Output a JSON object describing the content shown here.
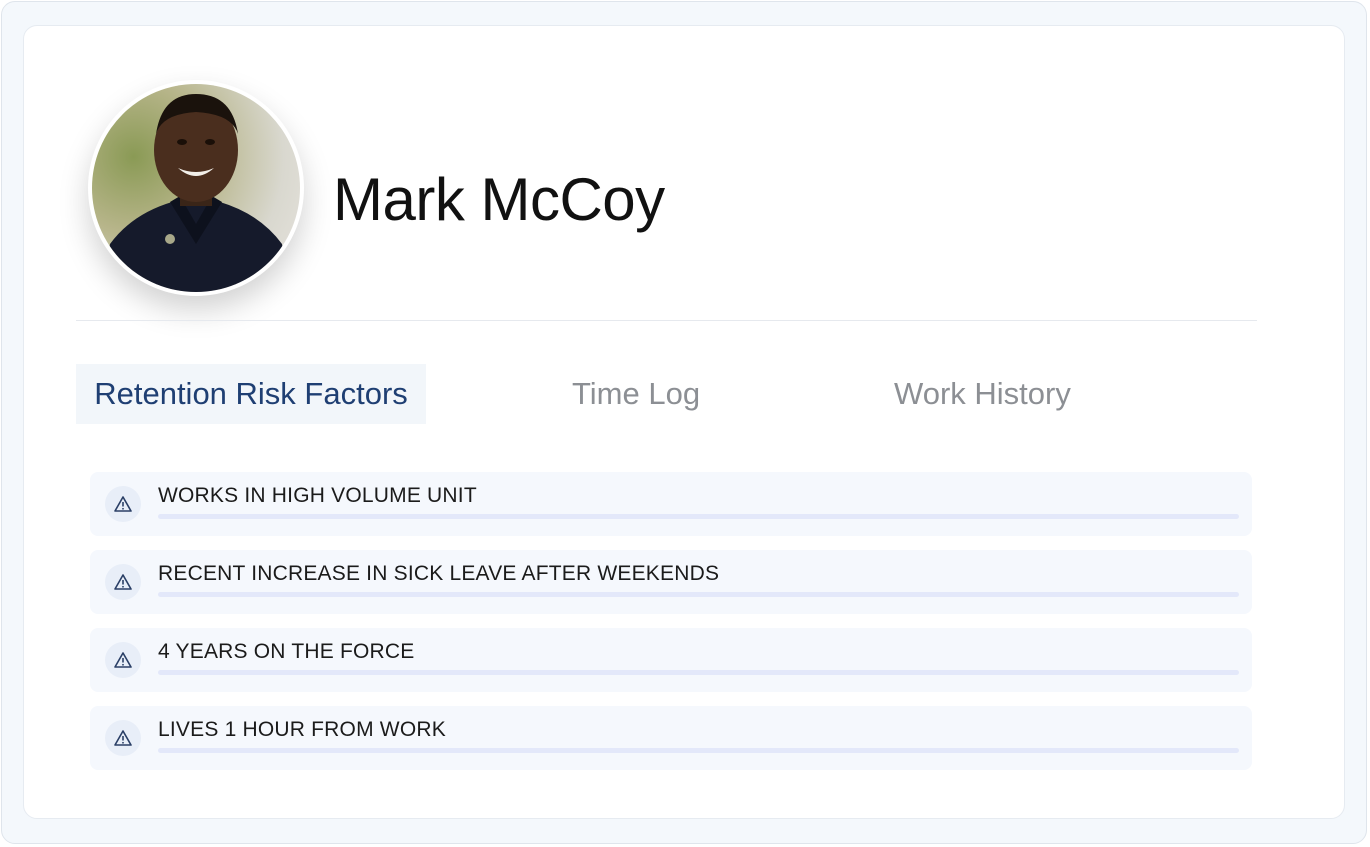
{
  "profile": {
    "name": "Mark McCoy",
    "avatar_icon": "person-photo"
  },
  "tabs": [
    {
      "label": "Retention Risk Factors",
      "active": true
    },
    {
      "label": "Time Log",
      "active": false
    },
    {
      "label": "Work History",
      "active": false
    }
  ],
  "risk_factors": [
    {
      "icon": "warning-triangle-icon",
      "label": "WORKS IN HIGH VOLUME UNIT"
    },
    {
      "icon": "warning-triangle-icon",
      "label": "RECENT INCREASE IN SICK LEAVE AFTER WEEKENDS"
    },
    {
      "icon": "warning-triangle-icon",
      "label": "4 YEARS ON THE FORCE"
    },
    {
      "icon": "warning-triangle-icon",
      "label": "LIVES 1 HOUR FROM WORK"
    }
  ],
  "colors": {
    "active_tab_text": "#1f3f73",
    "inactive_tab_text": "#8c8f94",
    "item_background": "#f5f8fd",
    "icon_color": "#2a3f66"
  }
}
